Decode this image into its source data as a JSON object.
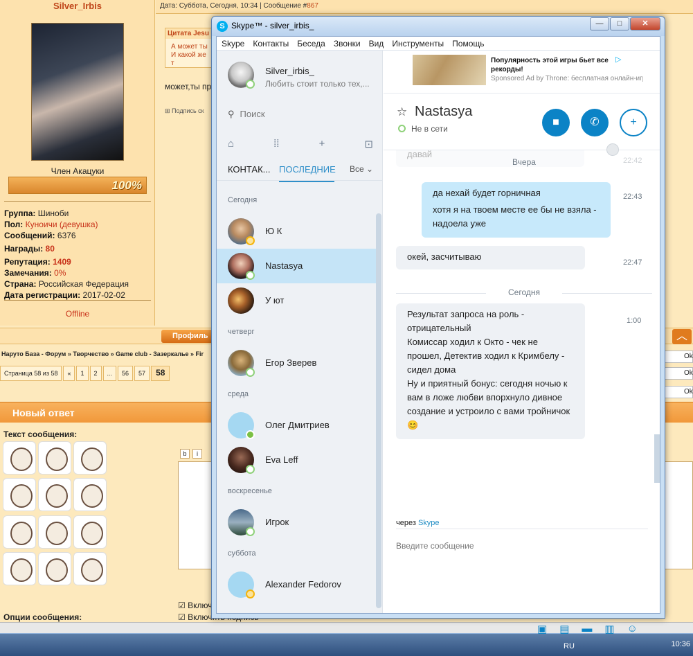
{
  "forum": {
    "username": "Silver_Irbis",
    "rank": "Член Акацуки",
    "rep_percent": "100%",
    "info": [
      {
        "label": "Группа:",
        "value": "Шиноби"
      },
      {
        "label": "Пол:",
        "value": "Куноичи (девушка)"
      },
      {
        "label": "Сообщений:",
        "value": "6376"
      },
      {
        "label": "Награды:",
        "value": "80"
      },
      {
        "label": "Репутация:",
        "value": "1409"
      },
      {
        "label": "Замечания:",
        "value": "0%"
      },
      {
        "label": "Страна:",
        "value": "Российская Федерация"
      },
      {
        "label": "Дата регистрации:",
        "value": "2017-02-02"
      }
    ],
    "status": "Offline",
    "post_date": "Дата: Суббота, Сегодня, 10:34 | Сообщение #",
    "post_num": "867",
    "quote_title": "Цитата Jesu",
    "quote_line1": "А может ты",
    "quote_line2": "И какой же т",
    "post_text": "может,ты пр",
    "subscribe": "Подпись ск",
    "profile_btn": "Профиль",
    "breadcrumbs": "Наруто База - Форум » Творчество » Game club - Зазеркалье » Fir",
    "pager": [
      "Страница 58 из 58",
      "«",
      "1",
      "2",
      "...",
      "56",
      "57",
      "58"
    ],
    "reply_title": "Новый ответ",
    "text_label": "Текст сообщения:",
    "options_label": "Опции сообщения:",
    "chk1": "Включ",
    "chk2": "Включить подпись",
    "ok": "Ok",
    "taskbar_lang": "RU",
    "clock": "10:36"
  },
  "skype": {
    "title": "Skype™ - silver_irbis_",
    "menu": [
      "Skype",
      "Контакты",
      "Беседа",
      "Звонки",
      "Вид",
      "Инструменты",
      "Помощь"
    ],
    "me_name": "Silver_irbis_",
    "me_mood": "Любить стоит только тех,...",
    "search_placeholder": "Поиск",
    "tab_contacts": "КОНТАК...",
    "tab_recent": "ПОСЛЕДНИЕ",
    "tab_all": "Все",
    "sections": {
      "today": "Сегодня",
      "thu": "четверг",
      "wed": "среда",
      "sun": "воскресенье",
      "sat": "суббота"
    },
    "contacts": [
      "Ю К",
      "Nastasya",
      "У ют",
      "Егор Зверев",
      "Олег Дмитриев",
      "Eva Leff",
      "Игрок",
      "Alexander Fedorov"
    ],
    "ad_title": "Популярность этой игры бьет все рекорды!",
    "ad_sub": "Sponsored Ad by Throne: бесплатная онлайн-игра",
    "contact_name": "Nastasya",
    "contact_status": "Не в сети",
    "day_yesterday": "Вчера",
    "faded_text": "давай",
    "faded_time": "22:42",
    "day_today": "Сегодня",
    "messages": [
      {
        "text": "да нехай будет горничная",
        "text2": "хотя я на твоем месте ее бы не взяла - надоела уже",
        "time": "22:43"
      },
      {
        "text": "окей, засчитываю",
        "time": "22:47"
      },
      {
        "text": "Результат запроса на роль - отрицательный\nКомиссар ходил к Окто - чек не прошел, Детектив ходил к Кримбелу - сидел дома\nНу и приятный бонус: сегодня ночью к вам в ложе любви впорхнуло дивное создание и устроило с вами тройничок 😊",
        "time": "1:00"
      }
    ],
    "via": "через",
    "via_link": "Skype",
    "composer_placeholder": "Введите сообщение"
  }
}
